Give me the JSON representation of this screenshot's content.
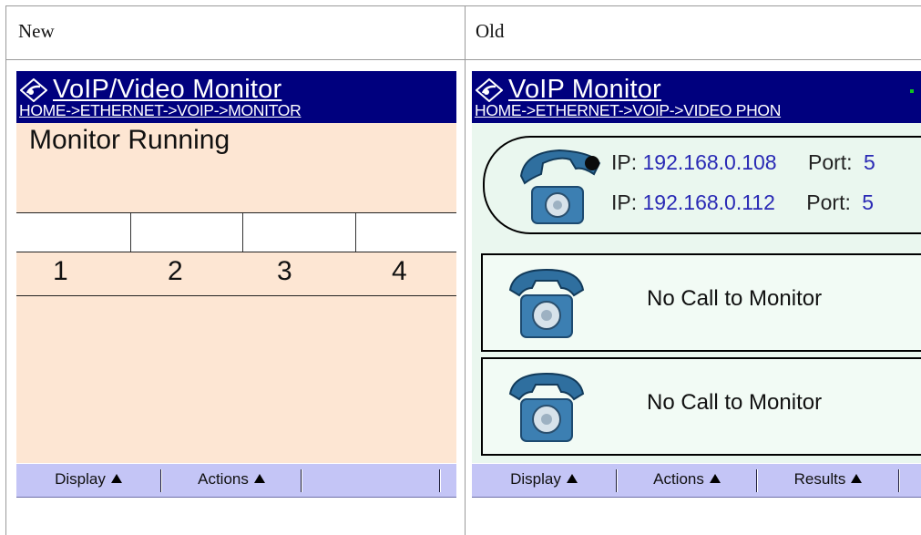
{
  "table": {
    "header_new": "New",
    "header_old": "Old"
  },
  "new_screen": {
    "title": "VoIP/Video Monitor",
    "breadcrumb": "HOME->ETHERNET->VOIP->MONITOR",
    "status": "Monitor Running",
    "channels": [
      "1",
      "2",
      "3",
      "4"
    ],
    "menu": {
      "display": "Display",
      "actions": "Actions"
    }
  },
  "old_screen": {
    "title": "VoIP Monitor",
    "breadcrumb": "HOME->ETHERNET->VOIP->VIDEO PHON",
    "call": {
      "ip_label": "IP:",
      "port_label": "Port:",
      "port_partial": "5",
      "ip1": "192.168.0.108",
      "ip2": "192.168.0.112"
    },
    "panels": [
      {
        "text": "No Call to Monitor"
      },
      {
        "text": "No Call to Monitor"
      }
    ],
    "menu": {
      "display": "Display",
      "actions": "Actions",
      "results": "Results"
    }
  },
  "colors": {
    "titlebar": "#00007e",
    "menubar": "#c4c5f6",
    "new_bg": "#fde6d3",
    "old_bg": "#eaf7ef",
    "ip_value": "#2a2ab5"
  },
  "icons": [
    "logo-icon",
    "phone-icon",
    "up-triangle-icon"
  ]
}
